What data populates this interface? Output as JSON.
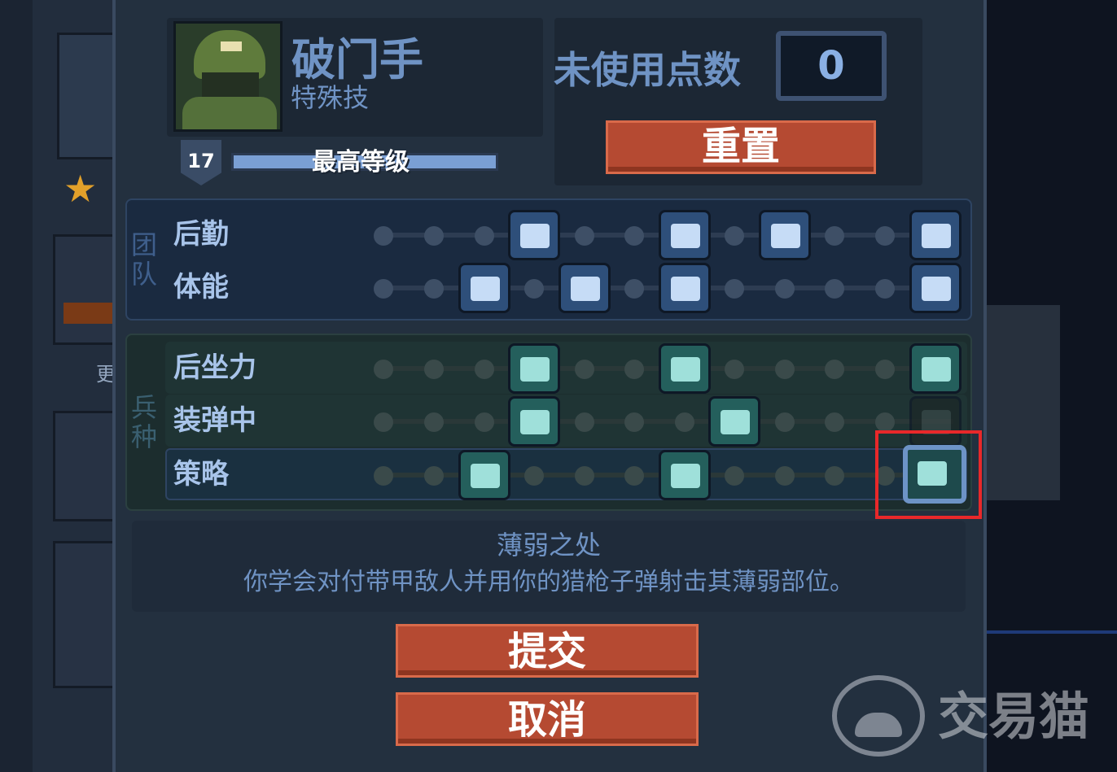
{
  "character": {
    "class_name": "破门手",
    "subtitle": "特殊技",
    "level": "17",
    "level_status": "最高等级",
    "xp_fraction": 1.0
  },
  "points": {
    "label": "未使用点数",
    "value": "0"
  },
  "buttons": {
    "reset": "重置",
    "submit": "提交",
    "cancel": "取消"
  },
  "sections": {
    "team_label": "团队",
    "class_label": "兵种"
  },
  "team_rows": [
    {
      "name": "后勤",
      "icons": [
        "ammo-crate-icon",
        "armor-plus-icon",
        "medkit-icon",
        "supply-kit-icon"
      ]
    },
    {
      "name": "体能",
      "icons": [
        "sprint-icon",
        "dash-icon",
        "vest-icon",
        "grit-icon"
      ]
    }
  ],
  "class_rows": [
    {
      "name": "后坐力",
      "icons": [
        "recoil-icon",
        "stability-icon",
        "spread-icon"
      ]
    },
    {
      "name": "装弹中",
      "icons": [
        "reload-plus-icon",
        "shells-icon",
        "locked-icon"
      ]
    },
    {
      "name": "策略",
      "icons": [
        "shatter-icon",
        "grip-icon",
        "weak-spot-icon"
      ]
    }
  ],
  "selected_perk": {
    "title": "薄弱之处",
    "description": "你学会对付带甲敌人并用你的猎枪子弹射击其薄弱部位。"
  },
  "background": {
    "side_label": "更"
  },
  "watermark": {
    "text": "交易猫"
  },
  "colors": {
    "accent_blue": "#6f93c4",
    "button_red": "#b54a32",
    "highlight_red": "#e8282a",
    "star_gold": "#e2a02a"
  }
}
